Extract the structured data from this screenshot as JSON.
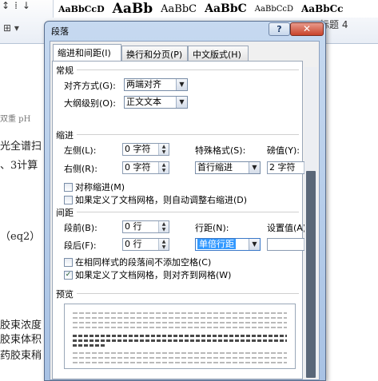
{
  "ribbon": {
    "quick_icons": [
      "↕",
      "⁞",
      "↓"
    ],
    "styles": [
      "AaBbCcD",
      "AaBb",
      "AaBbC",
      "AaBbC",
      "AaBbCcD",
      "AaBbCc"
    ],
    "grid_button": "⊞ ▾",
    "heading4": "标题 4"
  },
  "document": {
    "fragments": [
      "双重 pH",
      "光全谱扫",
      "、3计算",
      "（eq2）",
      "胶束浓度",
      "胶束体积",
      "药胶束稍"
    ]
  },
  "dialog": {
    "title": "段落",
    "help_label": "?",
    "close_label": "✕",
    "tabs": [
      "缩进和间距(I)",
      "换行和分页(P)",
      "中文版式(H)"
    ],
    "general": {
      "section": "常规",
      "alignment_label": "对齐方式(G):",
      "alignment_value": "两端对齐",
      "outline_label": "大纲级别(O):",
      "outline_value": "正文文本"
    },
    "indent": {
      "section": "缩进",
      "left_label": "左侧(L):",
      "left_value": "0 字符",
      "right_label": "右侧(R):",
      "right_value": "0 字符",
      "special_label": "特殊格式(S):",
      "special_value": "首行缩进",
      "by_label": "磅值(Y):",
      "by_value": "2 字符",
      "mirror": "对称缩进(M)",
      "auto_adjust": "如果定义了文档网格，则自动调整右缩进(D)"
    },
    "spacing": {
      "section": "间距",
      "before_label": "段前(B):",
      "before_value": "0 行",
      "after_label": "段后(F):",
      "after_value": "0 行",
      "line_label": "行距(N):",
      "line_value": "单倍行距",
      "at_label": "设置值(A):",
      "at_value": "",
      "no_space": "在相同样式的段落间不添加空格(C)",
      "snap_grid": "如果定义了文档网格，则对齐到网格(W)",
      "snap_grid_checked": true
    },
    "preview": {
      "section": "预览"
    }
  }
}
